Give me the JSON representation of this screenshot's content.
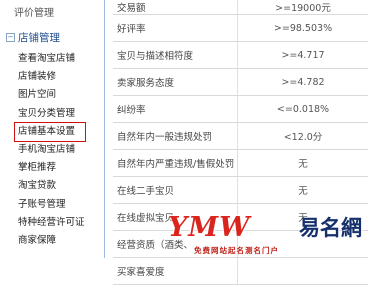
{
  "sidebar": {
    "top_partial": "评价管理",
    "group": {
      "toggle": "−",
      "label": "店铺管理"
    },
    "items": [
      {
        "label": "查看淘宝店铺"
      },
      {
        "label": "店铺装修"
      },
      {
        "label": "图片空间"
      },
      {
        "label": "宝贝分类管理"
      },
      {
        "label": "店铺基本设置",
        "active": true
      },
      {
        "label": "手机淘宝店铺"
      },
      {
        "label": "掌柜推荐"
      },
      {
        "label": "淘宝贷款"
      },
      {
        "label": "子账号管理"
      },
      {
        "label": "特种经营许可证"
      },
      {
        "label": "商家保障"
      }
    ]
  },
  "stats": {
    "rows": [
      {
        "label": "交易额",
        "value": ">=19000元"
      },
      {
        "label": "好评率",
        "value": ">=98.503%"
      },
      {
        "label": "宝贝与描述相符度",
        "value": ">=4.717"
      },
      {
        "label": "卖家服务态度",
        "value": ">=4.782"
      },
      {
        "label": "纠纷率",
        "value": "<=0.018%"
      },
      {
        "label": "自然年内一般违规处罚",
        "value": "<12.0分"
      },
      {
        "label": "自然年内严重违规/售假处罚",
        "value": "无"
      },
      {
        "label": "在线二手宝贝",
        "value": "无"
      },
      {
        "label": "在线虚拟宝贝",
        "value": "无"
      },
      {
        "label": "经营资质（酒类、",
        "value": ""
      },
      {
        "label": "买家喜爱度",
        "value": ""
      }
    ]
  },
  "watermark": {
    "brand": "YMW",
    "name": "易名網",
    "sub": "免费网站起名测名门户"
  }
}
